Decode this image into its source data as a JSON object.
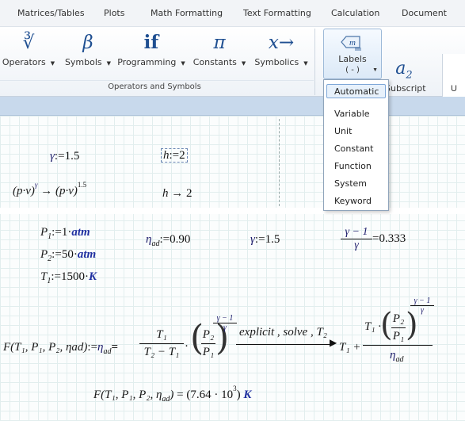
{
  "tabs": [
    "Matrices/Tables",
    "Plots",
    "Math Formatting",
    "Text Formatting",
    "Calculation",
    "Document"
  ],
  "ribbon": {
    "buttons": [
      {
        "icon": "∛",
        "label": "Operators"
      },
      {
        "icon": "β",
        "label": "Symbols"
      },
      {
        "icon": "if",
        "label": "Programming"
      },
      {
        "icon": "π",
        "label": "Constants"
      },
      {
        "icon": "x→",
        "label": "Symbolics"
      }
    ],
    "group_label": "Operators and Symbols",
    "labels": {
      "label": "Labels",
      "value": "( - )",
      "icon": "m"
    },
    "subscript": {
      "label": "Subscript",
      "icon": "a",
      "icon_sub": "2"
    },
    "right_edge": "U"
  },
  "dropdown": {
    "selected": "Automatic",
    "items": [
      "Variable",
      "Unit",
      "Constant",
      "Function",
      "System",
      "Keyword"
    ]
  },
  "worksheet": {
    "gamma_def": {
      "name": "γ",
      "op": ":=",
      "value": "1.5"
    },
    "h_def": {
      "name": "h",
      "op": ":=",
      "value": "2"
    },
    "pv_expr": {
      "left": "(p·v)",
      "left_exp": "γ",
      "arrow": "→",
      "right": "(p·v)",
      "right_exp": "1.5"
    },
    "h_eval": {
      "name": "h",
      "arrow": "→",
      "value": "2"
    },
    "p1": {
      "name": "P",
      "sub": "1",
      "op": ":=",
      "value": "1·",
      "unit": "atm"
    },
    "p2": {
      "name": "P",
      "sub": "2",
      "op": ":=",
      "value": "50·",
      "unit": "atm"
    },
    "t1": {
      "name": "T",
      "sub": "1",
      "op": ":=",
      "value": "1500·",
      "unit": "K"
    },
    "eta_def": {
      "name": "η",
      "sub": "ad",
      "op": ":=",
      "value": "0.90"
    },
    "gamma_def2": {
      "name": "γ",
      "op": ":=",
      "value": "1.5"
    },
    "ratio_eval": {
      "num": "γ − 1",
      "den": "γ",
      "op": "=",
      "value": "0.333"
    },
    "func_def": {
      "lhs": "F(T₁, P₁, P₂, ηad)",
      "assign": ":=",
      "eta": "η",
      "eta_sub": "ad",
      "eq": "=",
      "frac_num": "T₁",
      "frac_den": "T₂ − T₁",
      "mult": "·",
      "ratio_num": "P₂",
      "ratio_den": "P₁",
      "exp_num": "γ − 1",
      "exp_den": "γ",
      "keyword": "explicit , solve , T₂",
      "result_lead": "T₁ +",
      "result_num_lead": "T₁ ·",
      "result_den": "η",
      "result_den_sub": "ad"
    },
    "func_eval": {
      "lhs": "F(T₁, P₁, P₂, η",
      "lhs_sub": "ad",
      "lhs_end": ")",
      "eq": "=",
      "value": "(7.64 · 10",
      "exp": "3",
      "value_end": ")",
      "unit": "K"
    }
  }
}
